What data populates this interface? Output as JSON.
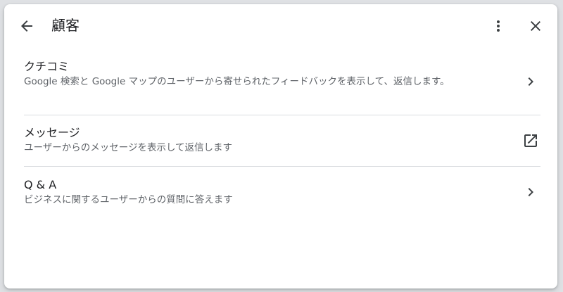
{
  "header": {
    "title": "顧客",
    "back_icon": "arrow-back-icon",
    "more_icon": "more-vert-icon",
    "close_icon": "close-icon"
  },
  "rows": [
    {
      "title": "クチコミ",
      "description": "Google 検索と Google マップのユーザーから寄せられたフィードバックを表示して、返信します。",
      "action_icon": "chevron-right-icon"
    },
    {
      "title": "メッセージ",
      "description": "ユーザーからのメッセージを表示して返信します",
      "action_icon": "open-in-new-icon"
    },
    {
      "title": "Q & A",
      "description": "ビジネスに関するユーザーからの質問に答えます",
      "action_icon": "chevron-right-icon"
    }
  ],
  "colors": {
    "text_primary": "#202124",
    "text_secondary": "#5f6368",
    "icon": "#3c4043",
    "divider": "#dadce0"
  }
}
